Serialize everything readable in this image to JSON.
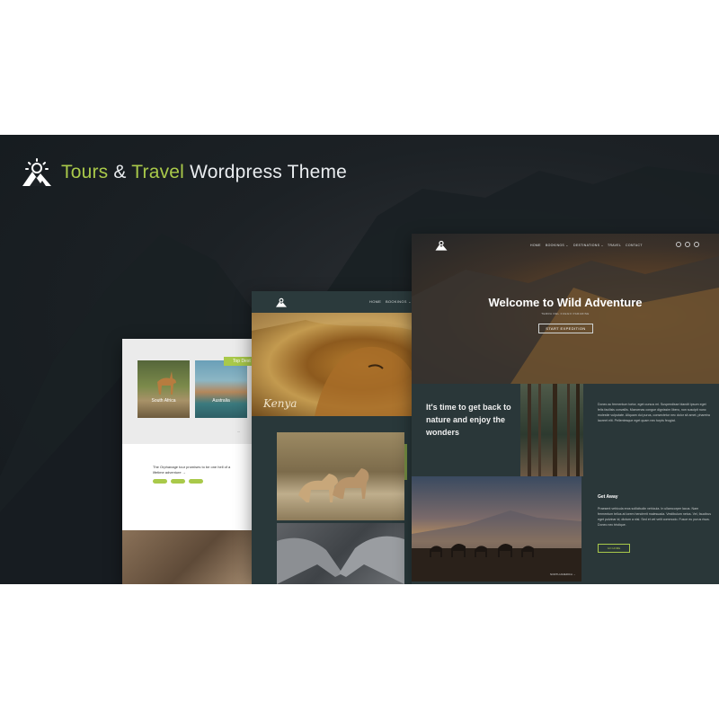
{
  "brand": {
    "title_part1": "Tours",
    "title_amp": " & ",
    "title_part2": "Travel",
    "title_rest": " Wordpress Theme",
    "icon": "mountain-sun-logo-icon",
    "accent_color": "#a9c94a"
  },
  "left_preview": {
    "badge": "Top Dest",
    "cards": [
      {
        "label": "South Africa"
      },
      {
        "label": "Australia"
      }
    ],
    "description": "The Orphanage tour promises to be one hell of a lifetime adventure  →",
    "tags": [
      "",
      "",
      ""
    ]
  },
  "middle_preview": {
    "nav": {
      "home": "HOME",
      "bookings": "BOOKINGS ⌄"
    },
    "hero_caption": "Kenya"
  },
  "right_preview": {
    "nav": [
      "HOME",
      "BOOKINGS ⌄",
      "DESTINATIONS ⌄",
      "TRAVEL",
      "CONTACT"
    ],
    "hero_title": "Welcome to Wild Adventure",
    "hero_subtitle": "TERRA DEL FUEGO PARADISE",
    "hero_button": "START EXPEDITION",
    "tagline": "It's time to get back to nature and enjoy the wonders",
    "paragraph1": "Donec ac fermentum tortor, eget cursus mi. Suspendisse blandit ipsum eget felis facilisis convallis. Maecenas congue dignissim libero, non suscipit nunc molestie vulputate. Aliquam dui purus, consectetur nec dolor sit amet, pharetra laoreet elit. Pellentesque eget quam nec turpis feugiat.",
    "image_caption": "NORTH AMERICA →",
    "getaway_title": "Get Away",
    "paragraph2": "Praesent vehicula eros sollicitudin vehicula. In ullamcorper lacus. Nam fermentum tellus at lorem hendrerit malesuada. Vestibulum netus. Vel, faucibus eget pulvinar id, dictum a nisl. Sed et vel velit commodo. Fusce eu purus risus. Donec nec tristique.",
    "button2": "GO HOME"
  }
}
